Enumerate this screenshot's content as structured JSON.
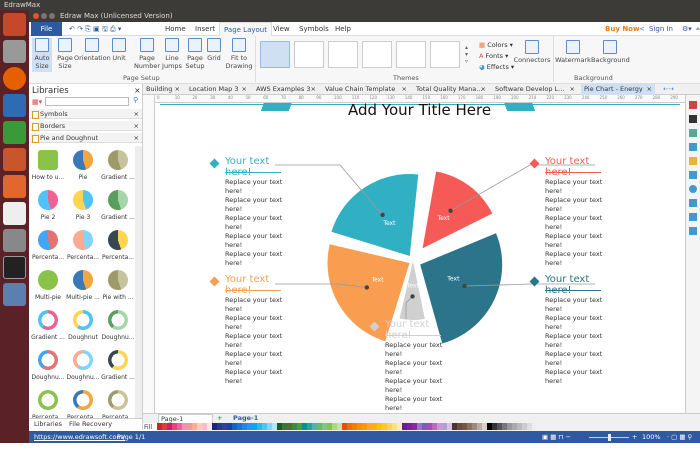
{
  "os": {
    "app_name": "EdrawMax"
  },
  "window": {
    "title": "Edraw Max (Unlicensed Version)"
  },
  "menu": {
    "file": "File",
    "items": [
      "Home",
      "Insert",
      "Page Layout",
      "View",
      "Symbols",
      "Help"
    ],
    "buy_now": "Buy Now",
    "sign_in": "Sign In"
  },
  "ribbon": {
    "page_setup": {
      "label": "Page Setup",
      "buttons": [
        "Auto Size",
        "Page Size",
        "Orientation",
        "Unit",
        "Page Number",
        "Line Jumps",
        "Page Setup",
        "Grid",
        "Fit to Drawing"
      ]
    },
    "themes": {
      "label": "Themes"
    },
    "style": {
      "colors": "Colors",
      "fonts": "Fonts",
      "effects": "Effects",
      "connectors": "Connectors"
    },
    "background": {
      "label": "Background",
      "watermark": "Watermark",
      "background": "Background"
    }
  },
  "libraries": {
    "title": "Libraries",
    "search_placeholder": "",
    "sections": [
      "Symbols",
      "Borders",
      "Pie and Doughnut"
    ],
    "shapes": [
      "How to u...",
      "Pie",
      "Gradient ...",
      "Pie 2",
      "Pie 3",
      "Gradient ...",
      "Percenta...",
      "Percenta...",
      "Percenta...",
      "Multi-pie",
      "Multi-pie ...",
      "Pie with ...",
      "Gradient ...",
      "Doughnut",
      "Doughnu...",
      "Doughnu...",
      "Doughnu...",
      "Gradient ...",
      "Percenta...",
      "Percenta...",
      "Percenta..."
    ],
    "bottom_tabs": [
      "Libraries",
      "File Recovery"
    ]
  },
  "doc_tabs": [
    "Building",
    "Location Map 3",
    "AWS Examples 3",
    "Value Chain Template",
    "Total Quality Mana...",
    "Software Develop L...",
    "Pie Chart - Energy"
  ],
  "ruler_ticks": [
    "0",
    "10",
    "20",
    "30",
    "40",
    "50",
    "60",
    "70",
    "80",
    "90",
    "100",
    "110",
    "120",
    "130",
    "140",
    "150",
    "160",
    "170",
    "180",
    "190",
    "200",
    "210",
    "220",
    "230",
    "240",
    "250",
    "260",
    "270",
    "280",
    "290"
  ],
  "canvas": {
    "title": "Add Your Title Here",
    "slice_label": "Text",
    "colors": {
      "red": "#f65a56",
      "dark": "#2b7489",
      "gray": "#cfd0cf",
      "orange": "#f99d50",
      "cyan": "#31b0c3"
    },
    "slices": [
      {
        "name": "red",
        "value": 16,
        "label": "Text"
      },
      {
        "name": "dark",
        "value": 28,
        "label": "Text"
      },
      {
        "name": "gray",
        "value": 8,
        "label": "Text"
      },
      {
        "name": "orange",
        "value": 25,
        "label": "Text"
      },
      {
        "name": "cyan",
        "value": 23,
        "label": "Text"
      }
    ],
    "callouts": [
      {
        "heading": "Your text here!",
        "lines": [
          "Replace your text here!",
          "Replace your text here!",
          "Replace your text here!",
          "Replace your text here!",
          "Replace your text here!"
        ]
      },
      {
        "heading": "Your text here!",
        "lines": [
          "Replace your text here!",
          "Replace your text here!",
          "Replace your text here!",
          "Replace your text here!",
          "Replace your text here!"
        ]
      },
      {
        "heading": "Your text here!",
        "lines": [
          "Replace your text here!",
          "Replace your text here!",
          "Replace your text here!",
          "Replace your text here!",
          "Replace your text here!"
        ]
      },
      {
        "heading": "Your text here!",
        "lines": [
          "Replace your text here!",
          "Replace your text here!",
          "Replace your text here!",
          "Replace your text here!",
          "Replace your text here!"
        ]
      },
      {
        "heading": "Your text here!",
        "lines": [
          "Replace your text here!",
          "Replace your text here!",
          "Replace your text here!",
          "Replace your text here!",
          "Replace your text here!"
        ]
      }
    ]
  },
  "pages": {
    "selector": "Page-1",
    "active": "Page-1",
    "fill_label": "Fill"
  },
  "status": {
    "url": "https://www.edrawsoft.com/",
    "page": "Page 1/1",
    "zoom": "100%",
    "zoom_level": 0.5
  }
}
